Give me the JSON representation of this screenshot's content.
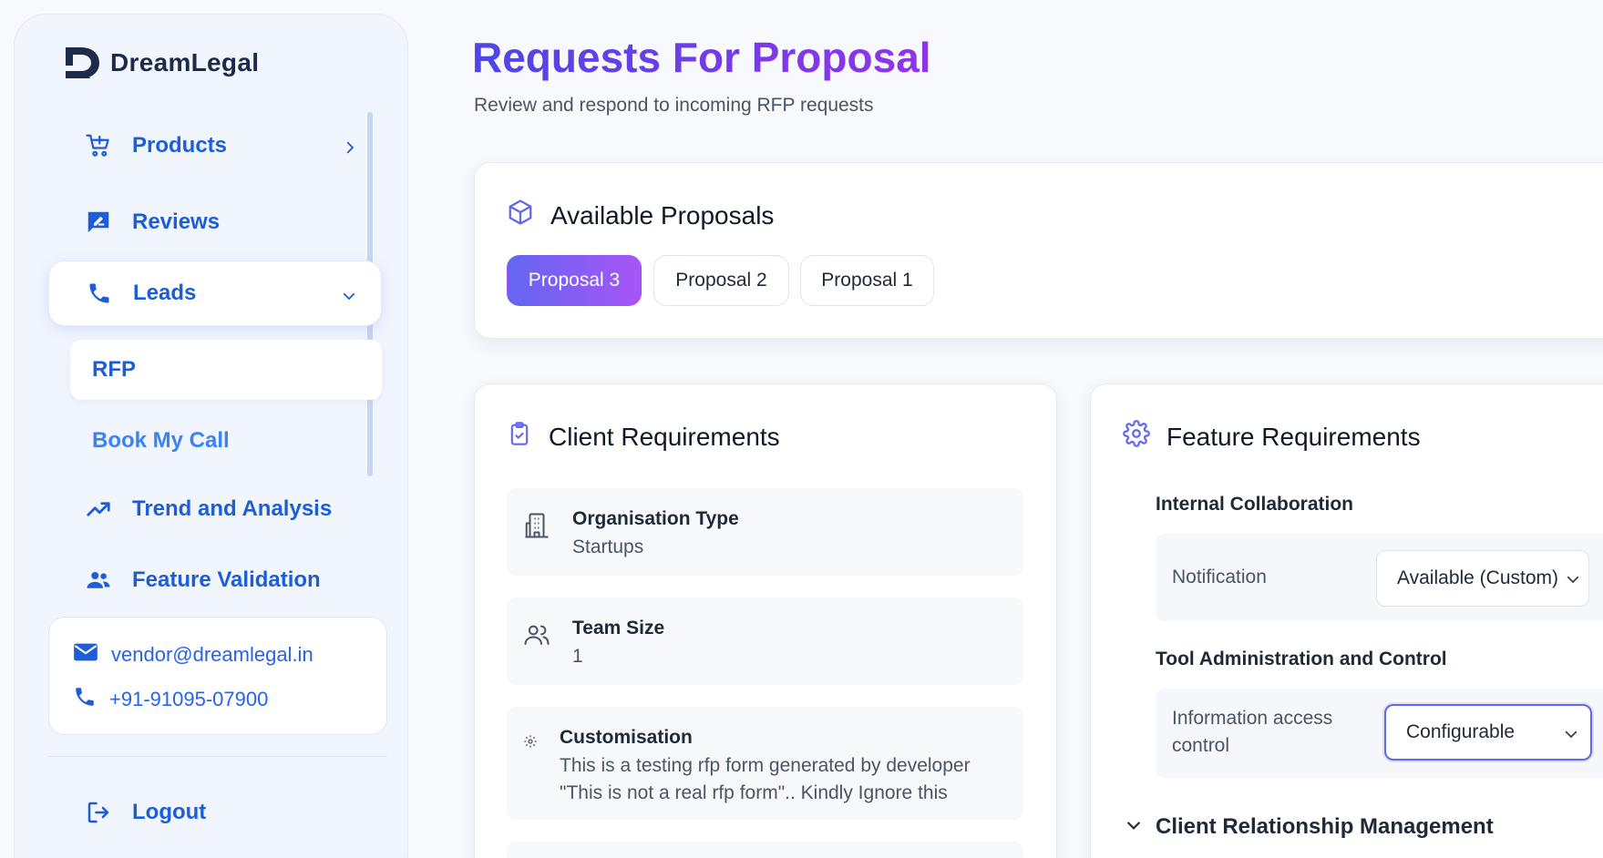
{
  "brand": {
    "name": "DreamLegal"
  },
  "sidebar": {
    "items": [
      {
        "label": "Products",
        "icon": "cart-plus-icon"
      },
      {
        "label": "Reviews",
        "icon": "review-pen-icon"
      },
      {
        "label": "Leads",
        "icon": "phone-icon"
      },
      {
        "label": "Trend and Analysis",
        "icon": "trending-up-icon"
      },
      {
        "label": "Feature Validation",
        "icon": "people-icon"
      }
    ],
    "sub_items": [
      {
        "label": "RFP"
      },
      {
        "label": "Book My Call"
      }
    ],
    "contact": {
      "email": "vendor@dreamlegal.in",
      "phone": "+91-91095-07900"
    },
    "logout_label": "Logout"
  },
  "header": {
    "title": "Requests For Proposal",
    "subtitle": "Review and respond to incoming RFP requests"
  },
  "proposals": {
    "title": "Available Proposals",
    "tabs": [
      {
        "label": "Proposal 3",
        "active": true
      },
      {
        "label": "Proposal 2",
        "active": false
      },
      {
        "label": "Proposal 1",
        "active": false
      }
    ]
  },
  "client": {
    "title": "Client Requirements",
    "fields": [
      {
        "label": "Organisation Type",
        "value": "Startups"
      },
      {
        "label": "Team Size",
        "value": "1"
      },
      {
        "label": "Customisation",
        "value_line1": "This is a testing rfp form generated by developer",
        "value_line2": "\"This is not a real rfp form\".. Kindly Ignore this"
      }
    ]
  },
  "features": {
    "title": "Feature Requirements",
    "sections": [
      {
        "title": "Internal Collaboration",
        "rows": [
          {
            "label": "Notification",
            "value": "Available (Custom)"
          }
        ]
      },
      {
        "title": "Tool Administration and Control",
        "rows": [
          {
            "label_line1": "Information access",
            "label_line2": "control",
            "value": "Configurable"
          }
        ]
      },
      {
        "title": "Client Relationship Management"
      }
    ]
  },
  "colors": {
    "accent_blue": "#1d5ed8",
    "gradient_start": "#6366f1",
    "gradient_end": "#a855f7"
  }
}
